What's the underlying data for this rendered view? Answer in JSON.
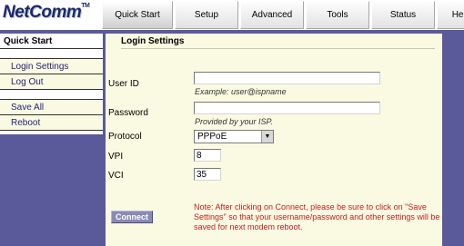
{
  "brand": {
    "logo_text": "NetComm",
    "logo_tm": "TM"
  },
  "nav": {
    "tabs": [
      {
        "label": "Quick Start",
        "active": true
      },
      {
        "label": "Setup"
      },
      {
        "label": "Advanced"
      },
      {
        "label": "Tools"
      },
      {
        "label": "Status"
      },
      {
        "label": "Help"
      }
    ]
  },
  "sidebar": {
    "heading": "Quick Start",
    "items": [
      {
        "label": "Login Settings"
      },
      {
        "label": "Log Out"
      },
      {
        "label": "Save All"
      },
      {
        "label": "Reboot"
      }
    ]
  },
  "main": {
    "section_title": "Login Settings",
    "fields": {
      "user_id": {
        "label": "User ID",
        "value": "",
        "hint": "Example: user@ispname"
      },
      "password": {
        "label": "Password",
        "value": "",
        "hint": "Provided by your ISP."
      },
      "protocol": {
        "label": "Protocol",
        "selected": "PPPoE"
      },
      "vpi": {
        "label": "VPI",
        "value": "8"
      },
      "vci": {
        "label": "VCI",
        "value": "35"
      }
    },
    "connect_label": "Connect",
    "note": "Note: After clicking on Connect, please be sure to click on \"Save Settings\" so that your username/password and other settings will be saved for next modem reboot."
  },
  "colors": {
    "frame": "#5a5a9a",
    "content_bg": "#fafae2",
    "link": "#22227a",
    "note": "#c41d1d",
    "button": "#8a8ab8"
  }
}
